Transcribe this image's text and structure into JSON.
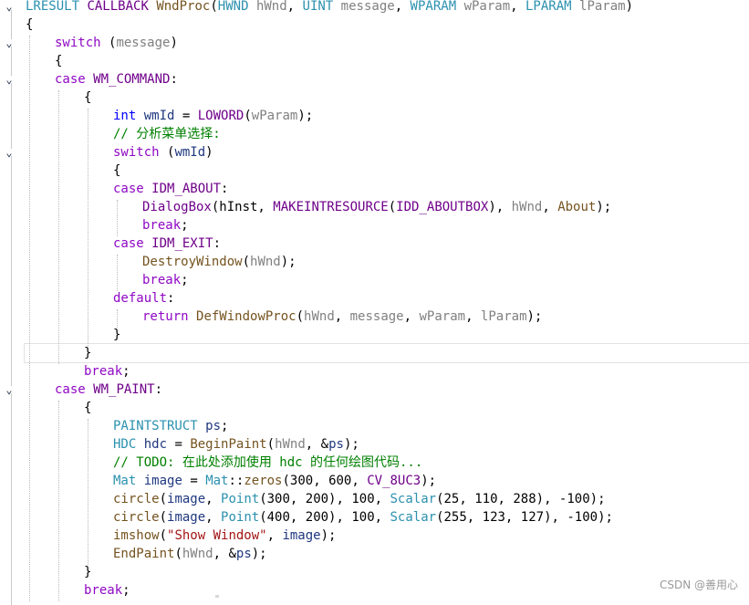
{
  "lines": [
    {
      "fold": "⌄",
      "indent": 0,
      "tokens": [
        [
          "t-type",
          "LRESULT"
        ],
        [
          "t-plain",
          " "
        ],
        [
          "t-macro",
          "CALLBACK"
        ],
        [
          "t-plain",
          " "
        ],
        [
          "t-fn",
          "WndProc"
        ],
        [
          "t-plain",
          "("
        ],
        [
          "t-type",
          "HWND"
        ],
        [
          "t-plain",
          " "
        ],
        [
          "t-param",
          "hWnd"
        ],
        [
          "t-plain",
          ", "
        ],
        [
          "t-type",
          "UINT"
        ],
        [
          "t-plain",
          " "
        ],
        [
          "t-param",
          "message"
        ],
        [
          "t-plain",
          ", "
        ],
        [
          "t-type",
          "WPARAM"
        ],
        [
          "t-plain",
          " "
        ],
        [
          "t-param",
          "wParam"
        ],
        [
          "t-plain",
          ", "
        ],
        [
          "t-type",
          "LPARAM"
        ],
        [
          "t-plain",
          " "
        ],
        [
          "t-param",
          "lParam"
        ],
        [
          "t-plain",
          ")"
        ]
      ]
    },
    {
      "fold": "",
      "indent": 0,
      "tokens": [
        [
          "t-plain",
          "{"
        ]
      ]
    },
    {
      "fold": "⌄",
      "indent": 1,
      "tokens": [
        [
          "t-ctl",
          "switch"
        ],
        [
          "t-plain",
          " ("
        ],
        [
          "t-param",
          "message"
        ],
        [
          "t-plain",
          ")"
        ]
      ]
    },
    {
      "fold": "",
      "indent": 1,
      "tokens": [
        [
          "t-plain",
          "{"
        ]
      ]
    },
    {
      "fold": "⌄",
      "indent": 1,
      "tokens": [
        [
          "t-ctl",
          "case"
        ],
        [
          "t-plain",
          " "
        ],
        [
          "t-macro",
          "WM_COMMAND"
        ],
        [
          "t-plain",
          ":"
        ]
      ]
    },
    {
      "fold": "",
      "indent": 2,
      "tokens": [
        [
          "t-plain",
          "{"
        ]
      ]
    },
    {
      "fold": "",
      "indent": 3,
      "tokens": [
        [
          "t-kw",
          "int"
        ],
        [
          "t-plain",
          " "
        ],
        [
          "t-local",
          "wmId"
        ],
        [
          "t-plain",
          " = "
        ],
        [
          "t-macro",
          "LOWORD"
        ],
        [
          "t-plain",
          "("
        ],
        [
          "t-param",
          "wParam"
        ],
        [
          "t-plain",
          ");"
        ]
      ]
    },
    {
      "fold": "",
      "indent": 3,
      "tokens": [
        [
          "t-cmt",
          "// 分析菜单选择:"
        ]
      ]
    },
    {
      "fold": "⌄",
      "indent": 3,
      "tokens": [
        [
          "t-ctl",
          "switch"
        ],
        [
          "t-plain",
          " ("
        ],
        [
          "t-local",
          "wmId"
        ],
        [
          "t-plain",
          ")"
        ]
      ]
    },
    {
      "fold": "",
      "indent": 3,
      "tokens": [
        [
          "t-plain",
          "{"
        ]
      ]
    },
    {
      "fold": "",
      "indent": 3,
      "tokens": [
        [
          "t-ctl",
          "case"
        ],
        [
          "t-plain",
          " "
        ],
        [
          "t-macro",
          "IDM_ABOUT"
        ],
        [
          "t-plain",
          ":"
        ]
      ]
    },
    {
      "fold": "",
      "indent": 4,
      "tokens": [
        [
          "t-macro",
          "DialogBox"
        ],
        [
          "t-plain",
          "(hInst, "
        ],
        [
          "t-macro",
          "MAKEINTRESOURCE"
        ],
        [
          "t-plain",
          "("
        ],
        [
          "t-macro",
          "IDD_ABOUTBOX"
        ],
        [
          "t-plain",
          "), "
        ],
        [
          "t-param",
          "hWnd"
        ],
        [
          "t-plain",
          ", "
        ],
        [
          "t-fn",
          "About"
        ],
        [
          "t-plain",
          ");"
        ]
      ]
    },
    {
      "fold": "",
      "indent": 4,
      "tokens": [
        [
          "t-ctl",
          "break"
        ],
        [
          "t-plain",
          ";"
        ]
      ]
    },
    {
      "fold": "",
      "indent": 3,
      "tokens": [
        [
          "t-ctl",
          "case"
        ],
        [
          "t-plain",
          " "
        ],
        [
          "t-macro",
          "IDM_EXIT"
        ],
        [
          "t-plain",
          ":"
        ]
      ]
    },
    {
      "fold": "",
      "indent": 4,
      "tokens": [
        [
          "t-fn",
          "DestroyWindow"
        ],
        [
          "t-plain",
          "("
        ],
        [
          "t-param",
          "hWnd"
        ],
        [
          "t-plain",
          ");"
        ]
      ]
    },
    {
      "fold": "",
      "indent": 4,
      "tokens": [
        [
          "t-ctl",
          "break"
        ],
        [
          "t-plain",
          ";"
        ]
      ]
    },
    {
      "fold": "",
      "indent": 3,
      "tokens": [
        [
          "t-ctl",
          "default"
        ],
        [
          "t-plain",
          ":"
        ]
      ]
    },
    {
      "fold": "",
      "indent": 4,
      "tokens": [
        [
          "t-ctl",
          "return"
        ],
        [
          "t-plain",
          " "
        ],
        [
          "t-fn",
          "DefWindowProc"
        ],
        [
          "t-plain",
          "("
        ],
        [
          "t-param",
          "hWnd"
        ],
        [
          "t-plain",
          ", "
        ],
        [
          "t-param",
          "message"
        ],
        [
          "t-plain",
          ", "
        ],
        [
          "t-param",
          "wParam"
        ],
        [
          "t-plain",
          ", "
        ],
        [
          "t-param",
          "lParam"
        ],
        [
          "t-plain",
          ");"
        ]
      ]
    },
    {
      "fold": "",
      "indent": 3,
      "tokens": [
        [
          "t-plain",
          "}"
        ]
      ]
    },
    {
      "fold": "",
      "indent": 2,
      "current": true,
      "tokens": [
        [
          "t-plain",
          "}"
        ]
      ]
    },
    {
      "fold": "",
      "indent": 2,
      "tokens": [
        [
          "t-ctl",
          "break"
        ],
        [
          "t-plain",
          ";"
        ]
      ]
    },
    {
      "fold": "⌄",
      "indent": 1,
      "tokens": [
        [
          "t-ctl",
          "case"
        ],
        [
          "t-plain",
          " "
        ],
        [
          "t-macro",
          "WM_PAINT"
        ],
        [
          "t-plain",
          ":"
        ]
      ]
    },
    {
      "fold": "",
      "indent": 2,
      "tokens": [
        [
          "t-plain",
          "{"
        ]
      ]
    },
    {
      "fold": "",
      "indent": 3,
      "tokens": [
        [
          "t-type",
          "PAINTSTRUCT"
        ],
        [
          "t-plain",
          " "
        ],
        [
          "t-local",
          "ps"
        ],
        [
          "t-plain",
          ";"
        ]
      ]
    },
    {
      "fold": "",
      "indent": 3,
      "tokens": [
        [
          "t-type",
          "HDC"
        ],
        [
          "t-plain",
          " "
        ],
        [
          "t-local",
          "hdc"
        ],
        [
          "t-plain",
          " = "
        ],
        [
          "t-fn",
          "BeginPaint"
        ],
        [
          "t-plain",
          "("
        ],
        [
          "t-param",
          "hWnd"
        ],
        [
          "t-plain",
          ", &"
        ],
        [
          "t-local",
          "ps"
        ],
        [
          "t-plain",
          ");"
        ]
      ]
    },
    {
      "fold": "",
      "indent": 3,
      "tokens": [
        [
          "t-cmt",
          "// TODO: 在此处添加使用 hdc 的任何绘图代码..."
        ]
      ]
    },
    {
      "fold": "",
      "indent": 3,
      "tokens": [
        [
          "t-type",
          "Mat"
        ],
        [
          "t-plain",
          " "
        ],
        [
          "t-local",
          "image"
        ],
        [
          "t-plain",
          " = "
        ],
        [
          "t-type",
          "Mat"
        ],
        [
          "t-plain",
          "::"
        ],
        [
          "t-fn",
          "zeros"
        ],
        [
          "t-plain",
          "(300, 600, "
        ],
        [
          "t-macro",
          "CV_8UC3"
        ],
        [
          "t-plain",
          ");"
        ]
      ]
    },
    {
      "fold": "",
      "indent": 3,
      "tokens": [
        [
          "t-fn",
          "circle"
        ],
        [
          "t-plain",
          "("
        ],
        [
          "t-local",
          "image"
        ],
        [
          "t-plain",
          ", "
        ],
        [
          "t-type",
          "Point"
        ],
        [
          "t-plain",
          "(300, 200), 100, "
        ],
        [
          "t-type",
          "Scalar"
        ],
        [
          "t-plain",
          "(25, 110, 288), -100);"
        ]
      ]
    },
    {
      "fold": "",
      "indent": 3,
      "tokens": [
        [
          "t-fn",
          "circle"
        ],
        [
          "t-plain",
          "("
        ],
        [
          "t-local",
          "image"
        ],
        [
          "t-plain",
          ", "
        ],
        [
          "t-type",
          "Point"
        ],
        [
          "t-plain",
          "(400, 200), 100, "
        ],
        [
          "t-type",
          "Scalar"
        ],
        [
          "t-plain",
          "(255, 123, 127), -100);"
        ]
      ]
    },
    {
      "fold": "",
      "indent": 3,
      "tokens": [
        [
          "t-fn",
          "imshow"
        ],
        [
          "t-plain",
          "("
        ],
        [
          "t-str",
          "\"Show Window\""
        ],
        [
          "t-plain",
          ", "
        ],
        [
          "t-local",
          "image"
        ],
        [
          "t-plain",
          ");"
        ]
      ]
    },
    {
      "fold": "",
      "indent": 3,
      "tokens": [
        [
          "t-fn",
          "EndPaint"
        ],
        [
          "t-plain",
          "("
        ],
        [
          "t-param",
          "hWnd"
        ],
        [
          "t-plain",
          ", &"
        ],
        [
          "t-local",
          "ps"
        ],
        [
          "t-plain",
          ");"
        ]
      ]
    },
    {
      "fold": "",
      "indent": 2,
      "tokens": [
        [
          "t-plain",
          "}"
        ]
      ]
    },
    {
      "fold": "",
      "indent": 2,
      "tokens": [
        [
          "t-ctl",
          "break"
        ],
        [
          "t-plain",
          ";"
        ]
      ]
    }
  ],
  "watermark": "CSDN @善用心"
}
